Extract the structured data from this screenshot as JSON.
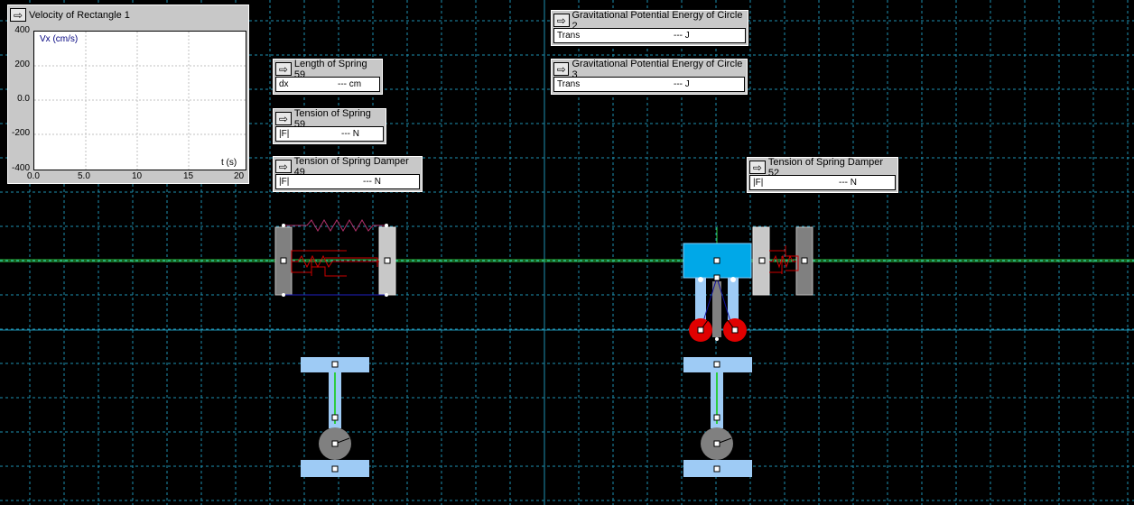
{
  "graph": {
    "title": "Velocity of Rectangle 1",
    "ylabel": "Vx (cm/s)",
    "xlabel": "t (s)",
    "yticks": [
      "400",
      "200",
      "0.0",
      "-200",
      "-400"
    ],
    "xticks": [
      "0.0",
      "5.0",
      "10",
      "15",
      "20"
    ]
  },
  "meters": {
    "length59": {
      "title": "Length of Spring 59",
      "label": "dx",
      "value": "--- cm"
    },
    "tension59": {
      "title": "Tension of Spring 59",
      "label": "|F|",
      "value": "--- N"
    },
    "damper49": {
      "title": "Tension of Spring Damper 49",
      "label": "|F|",
      "value": "--- N"
    },
    "gpe2": {
      "title": "Gravitational Potential Energy of Circle 2",
      "label": "Trans",
      "value": "--- J"
    },
    "gpe3": {
      "title": "Gravitational Potential Energy of Circle 3",
      "label": "Trans",
      "value": "--- J"
    },
    "damper52": {
      "title": "Tension of Spring Damper 52",
      "label": "|F|",
      "value": "--- N"
    }
  },
  "icons": {
    "meter_button": "arrow-right-icon"
  },
  "colors": {
    "background": "#000000",
    "grid": "#1e90b0",
    "axis": "#1e90b0",
    "ground_line": "#2ecc40",
    "body_blue": "#00a8e8",
    "light_blue": "#9ecbf5",
    "wheel_red": "#e00000",
    "gray_block": "#808080",
    "light_gray_block": "#c8c8c8",
    "spring_red": "#cc0000",
    "spring_purple": "#b0306a"
  }
}
